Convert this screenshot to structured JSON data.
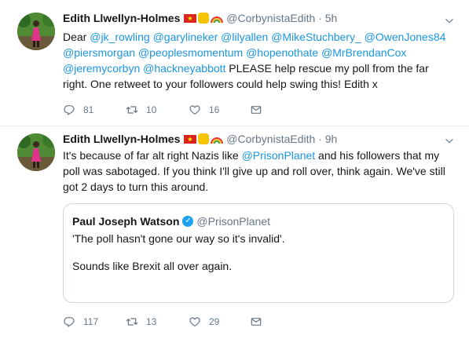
{
  "tweets": [
    {
      "name": "Edith Llwellyn-Holmes",
      "handle": "@CorbynistaEdith",
      "dot": "·",
      "time": "5h",
      "segments": [
        {
          "text": "Dear ",
          "link": false
        },
        {
          "text": "@jk_rowling",
          "link": true
        },
        {
          "text": " ",
          "link": false
        },
        {
          "text": "@garylineker",
          "link": true
        },
        {
          "text": " ",
          "link": false
        },
        {
          "text": "@lilyallen",
          "link": true
        },
        {
          "text": " ",
          "link": false
        },
        {
          "text": "@MikeStuchbery_",
          "link": true
        },
        {
          "text": " ",
          "link": false
        },
        {
          "text": "@OwenJones84",
          "link": true
        },
        {
          "text": " ",
          "link": false
        },
        {
          "text": "@piersmorgan",
          "link": true
        },
        {
          "text": " ",
          "link": false
        },
        {
          "text": "@peoplesmomentum",
          "link": true
        },
        {
          "text": " ",
          "link": false
        },
        {
          "text": "@hopenothate",
          "link": true
        },
        {
          "text": " ",
          "link": false
        },
        {
          "text": "@MrBrendanCox",
          "link": true
        },
        {
          "text": " ",
          "link": false
        },
        {
          "text": "@jeremycorbyn",
          "link": true
        },
        {
          "text": " ",
          "link": false
        },
        {
          "text": "@hackneyabbott",
          "link": true
        },
        {
          "text": " PLEASE help rescue my poll from the far right. One retweet to your followers could help swing this! Edith x",
          "link": false
        }
      ],
      "replies": "81",
      "retweets": "10",
      "likes": "16"
    },
    {
      "name": "Edith Llwellyn-Holmes",
      "handle": "@CorbynistaEdith",
      "dot": "·",
      "time": "9h",
      "segments": [
        {
          "text": "It's because of far alt right Nazis like ",
          "link": false
        },
        {
          "text": "@PrisonPlanet",
          "link": true
        },
        {
          "text": " and his followers that my poll was sabotaged. If you think I'll give up and roll over, think again. We've still got 2 days to turn this around.",
          "link": false
        }
      ],
      "quote": {
        "name": "Paul Joseph Watson",
        "handle": "@PrisonPlanet",
        "line1": "'The poll hasn't gone our way so it's invalid'.",
        "line2": "Sounds like Brexit all over again."
      },
      "replies": "117",
      "retweets": "13",
      "likes": "29"
    }
  ],
  "colors": {
    "link": "#1b95e0",
    "muted": "#657786",
    "border": "#e6ecf0"
  }
}
